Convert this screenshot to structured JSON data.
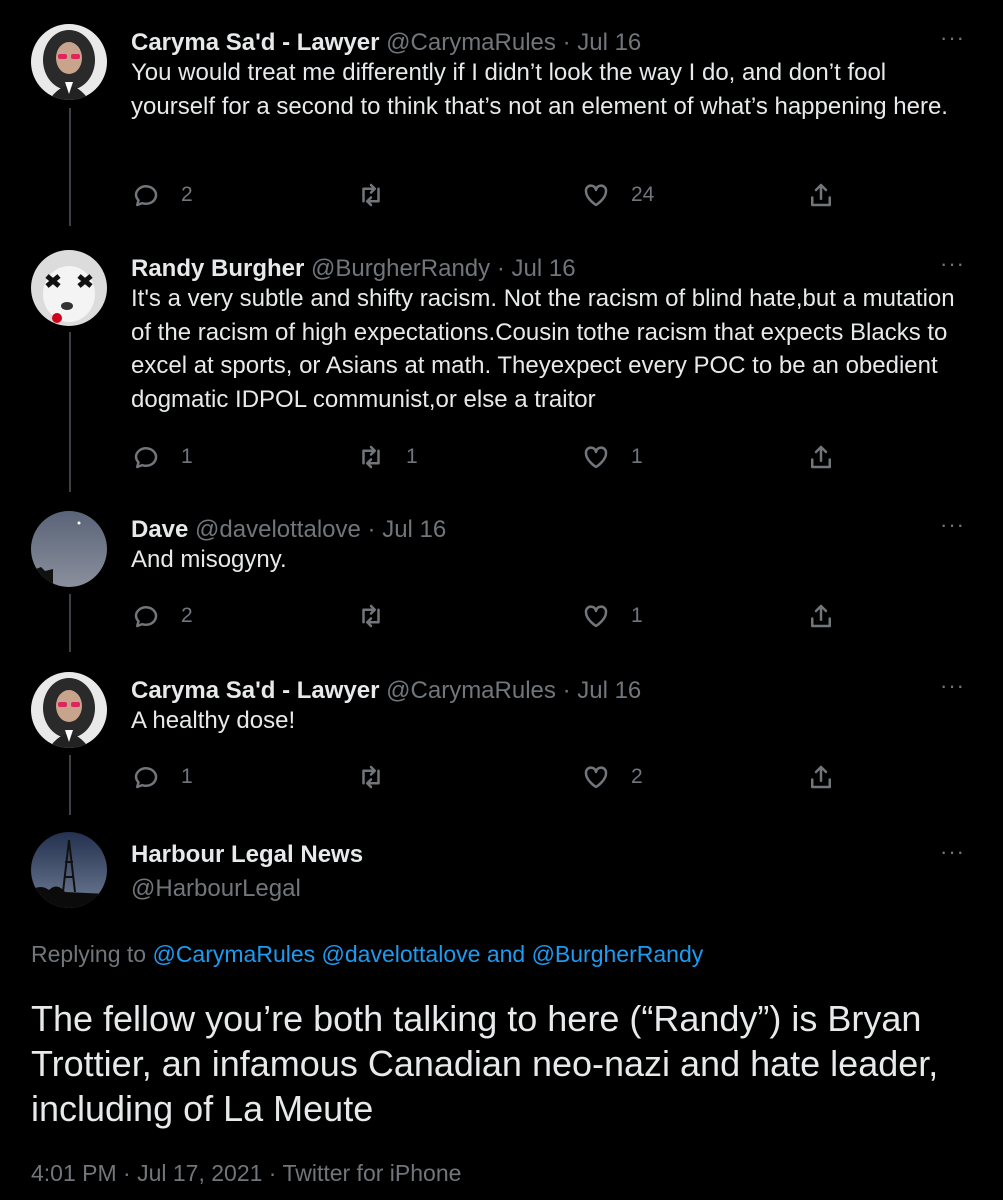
{
  "thread": [
    {
      "name": "Caryma Sa'd - Lawyer",
      "handle": "@CarymaRules",
      "separator": "·",
      "date": "Jul 16",
      "text": "You would treat me differently if I didn’t look the way I do, and don’t fool yourself for a second to think that’s not an element of what’s happening here.",
      "replies": "2",
      "retweets": "",
      "likes": "24"
    },
    {
      "name": "Randy Burgher",
      "handle": "@BurgherRandy",
      "separator": "·",
      "date": "Jul 16",
      "text": "It's a very subtle and shifty racism. Not the racism of blind hate,but a mutation of the racism of high expectations.Cousin tothe racism that expects Blacks to excel at sports, or Asians at math. Theyexpect every POC to be an obedient dogmatic  IDPOL communist,or else a traitor",
      "replies": "1",
      "retweets": "1",
      "likes": "1"
    },
    {
      "name": "Dave",
      "handle": "@davelottalove",
      "separator": "·",
      "date": "Jul 16",
      "text": "And misogyny.",
      "replies": "2",
      "retweets": "",
      "likes": "1"
    },
    {
      "name": "Caryma Sa'd - Lawyer",
      "handle": "@CarymaRules",
      "separator": "·",
      "date": "Jul 16",
      "text": "A healthy dose!",
      "replies": "1",
      "retweets": "",
      "likes": "2"
    }
  ],
  "main": {
    "name": "Harbour Legal News",
    "handle": "@HarbourLegal",
    "more": "···",
    "replying_prefix": "Replying to",
    "replying_mentions": "@CarymaRules @davelottalove",
    "replying_and": "and",
    "replying_last": "@BurgherRandy",
    "text": "The fellow you’re both talking to here (“Randy”) is Bryan Trottier, an infamous Canadian neo-nazi and hate leader, including of La Meute",
    "timestamp": "4:01 PM · Jul 17, 2021 · Twitter for iPhone"
  },
  "ui": {
    "more": "···",
    "icons": [
      "reply-icon",
      "retweet-icon",
      "like-icon",
      "share-icon",
      "more-icon"
    ],
    "colors": {
      "background": "#000000",
      "text": "#e7e9ea",
      "muted": "#71767b",
      "link": "#1d9bf0"
    }
  }
}
